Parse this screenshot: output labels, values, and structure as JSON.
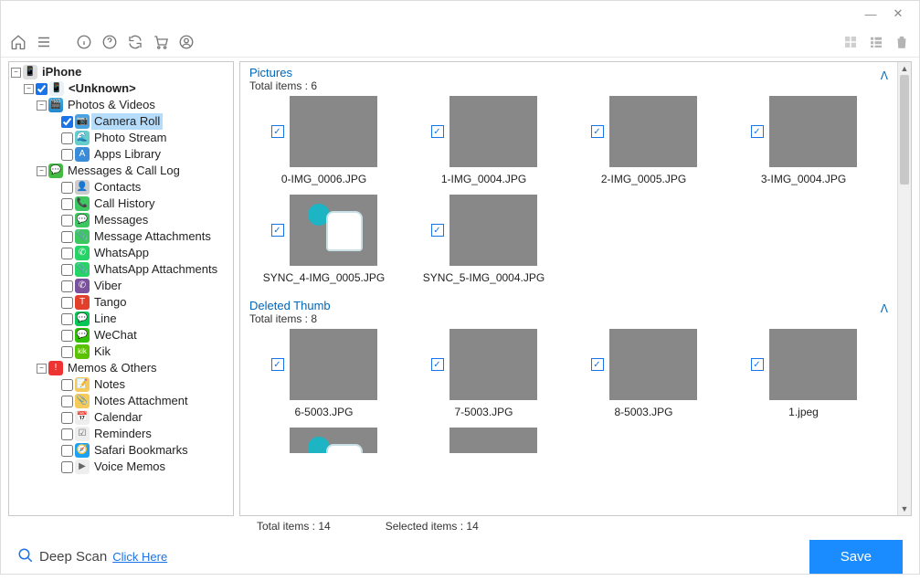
{
  "toolbar": {
    "view_grid": "grid-view",
    "view_list": "list-view",
    "view_delete": "trash"
  },
  "tree": {
    "root": "iPhone",
    "device": "<Unknown>",
    "cat_photos": "Photos & Videos",
    "photos": [
      "Camera Roll",
      "Photo Stream",
      "Apps Library"
    ],
    "cat_msg": "Messages & Call Log",
    "msgs": [
      "Contacts",
      "Call History",
      "Messages",
      "Message Attachments",
      "WhatsApp",
      "WhatsApp Attachments",
      "Viber",
      "Tango",
      "Line",
      "WeChat",
      "Kik"
    ],
    "cat_memo": "Memos & Others",
    "memos": [
      "Notes",
      "Notes Attachment",
      "Calendar",
      "Reminders",
      "Safari Bookmarks",
      "Voice Memos"
    ]
  },
  "sections": {
    "pictures": {
      "title": "Pictures",
      "sub": "Total items : 6",
      "items": [
        "0-IMG_0006.JPG",
        "1-IMG_0004.JPG",
        "2-IMG_0005.JPG",
        "3-IMG_0004.JPG",
        "SYNC_4-IMG_0005.JPG",
        "SYNC_5-IMG_0004.JPG"
      ]
    },
    "deleted": {
      "title": "Deleted Thumb",
      "sub": "Total items : 8",
      "items": [
        "6-5003.JPG",
        "7-5003.JPG",
        "8-5003.JPG",
        "1.jpeg"
      ]
    }
  },
  "status": {
    "total": "Total items : 14",
    "selected": "Selected items : 14"
  },
  "deepscan": {
    "label": "Deep Scan",
    "link": "Click Here"
  },
  "save": "Save"
}
